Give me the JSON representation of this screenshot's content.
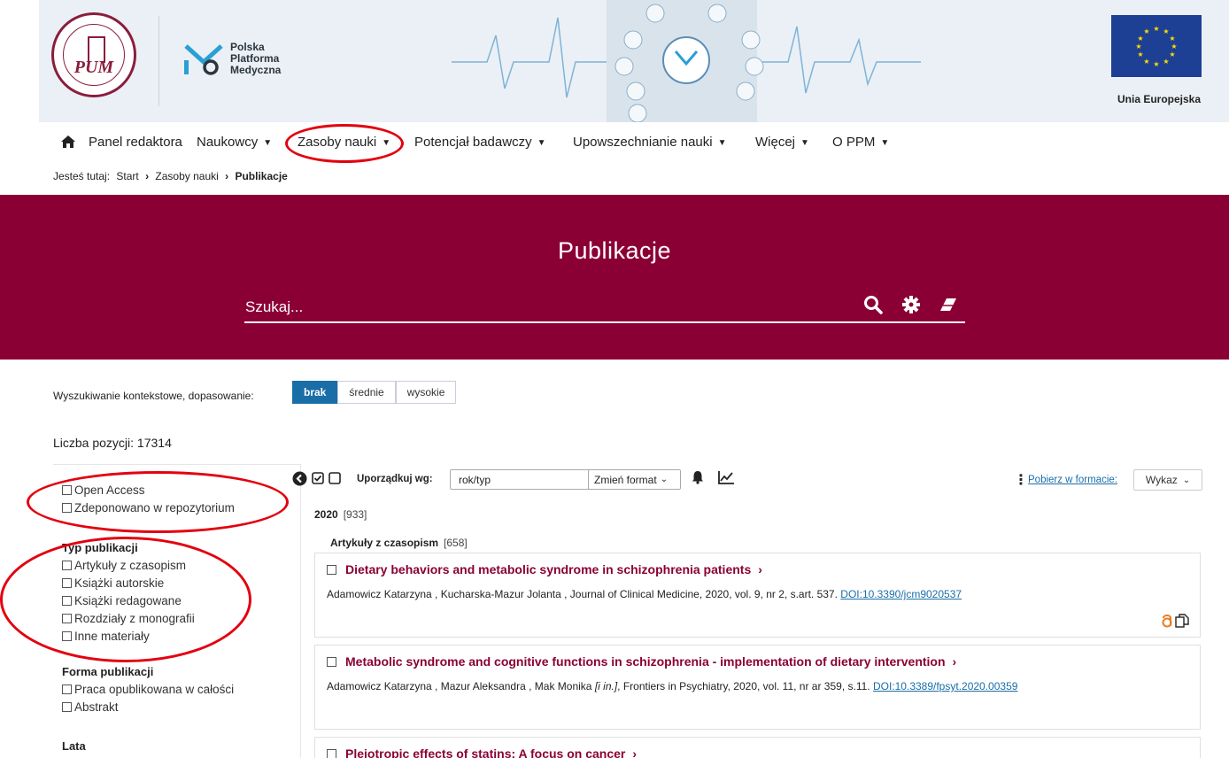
{
  "banner": {
    "ppm_lines": [
      "Polska",
      "Platforma",
      "Medyczna"
    ],
    "pum_text": "PUM",
    "eu_label": "Unia Europejska"
  },
  "nav": {
    "items": [
      {
        "label": "Panel redaktora",
        "caret": false
      },
      {
        "label": "Naukowcy",
        "caret": true
      },
      {
        "label": "Zasoby nauki",
        "caret": true
      },
      {
        "label": "Potencjał badawczy",
        "caret": true
      },
      {
        "label": "Upowszechnianie nauki",
        "caret": true
      },
      {
        "label": "Więcej",
        "caret": true
      },
      {
        "label": "O PPM",
        "caret": true
      }
    ]
  },
  "breadcrumb": {
    "prefix": "Jesteś tutaj:",
    "items": [
      "Start",
      "Zasoby nauki",
      "Publikacje"
    ]
  },
  "hero": {
    "title": "Publikacje",
    "search_placeholder": "Szukaj..."
  },
  "context_search": {
    "label": "Wyszukiwanie kontekstowe, dopasowanie:",
    "options": [
      "brak",
      "średnie",
      "wysokie"
    ],
    "selected": "brak"
  },
  "count_label": "Liczba pozycji: 17314",
  "sidebar": {
    "access": [
      "Open Access",
      "Zdeponowano w repozytorium"
    ],
    "type_title": "Typ publikacji",
    "types": [
      "Artykuły z czasopism",
      "Książki autorskie",
      "Książki redagowane",
      "Rozdziały z monografii",
      "Inne materiały"
    ],
    "form_title": "Forma publikacji",
    "forms": [
      "Praca opublikowana w całości",
      "Abstrakt"
    ],
    "years_title": "Lata"
  },
  "toolbar": {
    "sort_label": "Uporządkuj wg:",
    "sort_value": "rok/typ",
    "format_label": "Zmień format",
    "download_label": "Pobierz w formacie:",
    "list_label": "Wykaz"
  },
  "results": {
    "year": "2020",
    "year_count": "[933]",
    "type": "Artykuły z czasopism",
    "type_count": "[658]",
    "items": [
      {
        "title": "Dietary behaviors and metabolic syndrome in schizophrenia patients",
        "meta": "Adamowicz Katarzyna , Kucharska-Mazur Jolanta , Journal of Clinical Medicine, 2020, vol. 9, nr 2, s.art. 537.",
        "doi": "DOI:10.3390/jcm9020537"
      },
      {
        "title": "Metabolic syndrome and cognitive functions in schizophrenia - implementation of dietary intervention",
        "meta_a": "Adamowicz Katarzyna , Mazur Aleksandra , Mak Monika",
        "meta_italic": "[i in.]",
        "meta_b": ", Frontiers in Psychiatry, 2020, vol. 11, nr ar 359, s.11.",
        "doi": "DOI:10.3389/fpsyt.2020.00359"
      },
      {
        "title": "Pleiotropic effects of statins: A focus on cancer"
      }
    ]
  },
  "colors": {
    "brand": "#8b0034",
    "link": "#1a6ea8",
    "annotation": "#e3000f",
    "oa_icon": "#e67e22"
  }
}
